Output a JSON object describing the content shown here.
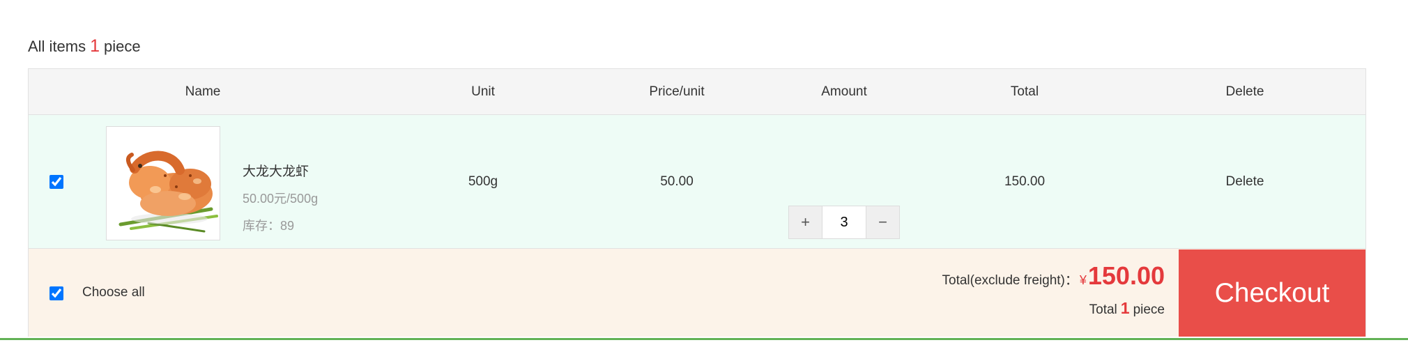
{
  "summary": {
    "prefix": "All items",
    "count": "1",
    "suffix": "piece"
  },
  "header": {
    "name": "Name",
    "unit": "Unit",
    "price": "Price/unit",
    "amount": "Amount",
    "total": "Total",
    "delete": "Delete"
  },
  "item": {
    "checked": true,
    "title": "大龙大龙虾",
    "price_line": "50.00元/500g",
    "stock": "库存：89",
    "unit": "500g",
    "price": "50.00",
    "quantity": "3",
    "plus": "+",
    "minus": "−",
    "total": "150.00",
    "delete": "Delete"
  },
  "footer": {
    "select_all_checked": true,
    "select_all_label": "Choose all",
    "total_label": "Total(exclude freight)：",
    "currency": "¥",
    "total_amount": "150.00",
    "count_prefix": "Total",
    "count": "1",
    "count_suffix": "piece",
    "checkout_label": "Checkout"
  },
  "colors": {
    "accent_red": "#e4393c",
    "checkout_bg": "#e94e49",
    "row_bg": "#eefcf6",
    "footer_bg": "#fcf3e9",
    "header_bg": "#f5f5f5",
    "bottom_line": "#62b256"
  }
}
